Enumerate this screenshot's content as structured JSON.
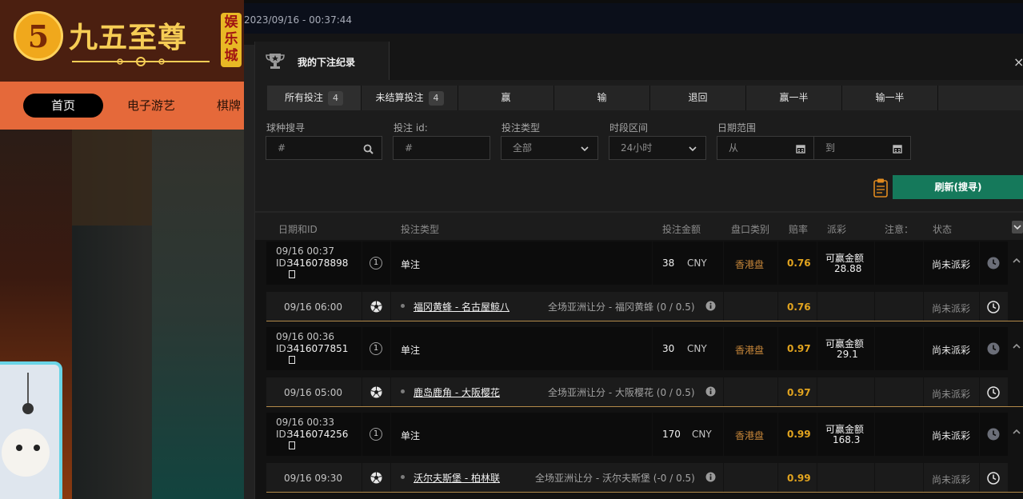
{
  "site": {
    "logo_glyph": "5",
    "title": "九五至尊",
    "badge": "娱乐城",
    "nav": [
      "首页",
      "电子游艺",
      "棋牌"
    ]
  },
  "datetime": "2023/09/16 - 00:37:44",
  "panel": {
    "title": "我的下注纪录",
    "close": "×",
    "tabs": [
      {
        "label": "所有投注",
        "count": "4"
      },
      {
        "label": "未结算投注",
        "count": "4"
      },
      {
        "label": "赢"
      },
      {
        "label": "输"
      },
      {
        "label": "退回"
      },
      {
        "label": "赢一半"
      },
      {
        "label": "输一半"
      }
    ],
    "filters": {
      "sport_label": "球种搜寻",
      "sport_placeholder": "#",
      "betid_label": "投注 id:",
      "betid_placeholder": "#",
      "bettype_label": "投注类型",
      "bettype_value": "全部",
      "period_label": "时段区间",
      "period_value": "24小时",
      "date_label": "日期范围",
      "date_from": "从",
      "date_to": "到"
    },
    "refresh_label": "刷新(搜寻)",
    "columns": [
      "日期和ID",
      "投注类型",
      "投注金额",
      "盘口类别",
      "赔率",
      "派彩",
      "注意：",
      "状态"
    ],
    "bets": [
      {
        "time": "09/16 00:37",
        "id_prefix": "ID:",
        "id": "3416078898",
        "legs": "1",
        "type": "单注",
        "amount": "38",
        "currency": "CNY",
        "market": "香港盘",
        "odds": "0.76",
        "payout_label": "可赢金额",
        "payout": "28.88",
        "status": "尚未派彩",
        "match_time": "09/16 06:00",
        "match": "福冈黄蜂 - 名古屋鲸八",
        "handicap": "全场亚洲让分 - 福冈黄蜂 (0 / 0.5)",
        "leg_odds": "0.76",
        "leg_status": "尚未派彩"
      },
      {
        "time": "09/16 00:36",
        "id_prefix": "ID:",
        "id": "3416077851",
        "legs": "1",
        "type": "单注",
        "amount": "30",
        "currency": "CNY",
        "market": "香港盘",
        "odds": "0.97",
        "payout_label": "可赢金额",
        "payout": "29.1",
        "status": "尚未派彩",
        "match_time": "09/16 05:00",
        "match": "鹿岛鹿角 - 大阪樱花",
        "handicap": "全场亚洲让分 - 大阪樱花 (0 / 0.5)",
        "leg_odds": "0.97",
        "leg_status": "尚未派彩"
      },
      {
        "time": "09/16 00:33",
        "id_prefix": "ID:",
        "id": "3416074256",
        "legs": "1",
        "type": "单注",
        "amount": "170",
        "currency": "CNY",
        "market": "香港盘",
        "odds": "0.99",
        "payout_label": "可赢金额",
        "payout": "168.3",
        "status": "尚未派彩",
        "match_time": "09/16 09:30",
        "match": "沃尔夫斯堡 - 柏林联",
        "handicap": "全场亚洲让分 - 沃尔夫斯堡 (-0 / 0.5)",
        "leg_odds": "0.99",
        "leg_status": "尚未派彩"
      }
    ]
  },
  "colors": {
    "accent_green": "#15795b",
    "odds_gold": "#e2a41f",
    "market_orange": "#c8873a",
    "nav_orange": "#e5693a"
  },
  "icons": [
    "trophy-icon",
    "search-icon",
    "chevron-down-icon",
    "calendar-icon",
    "clipboard-icon",
    "soccer-ball-icon",
    "clock-icon",
    "copy-icon",
    "chevron-up-icon",
    "info-icon",
    "close-icon"
  ]
}
